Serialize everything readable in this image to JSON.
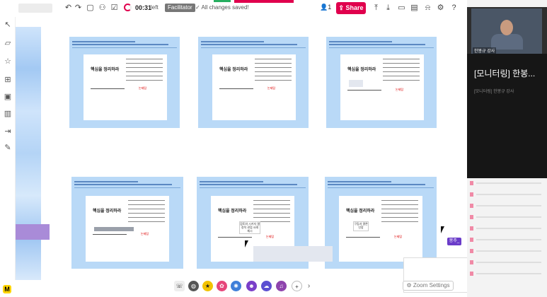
{
  "toolbar": {
    "timer": "00:31",
    "timer_suffix": "left",
    "facilitator_badge": "Facilitator",
    "saved_status": "All changes saved!",
    "user_count": "1",
    "share_label": "Share"
  },
  "slides": [
    {
      "title": "핵심을 정리하라",
      "red_note": "논제탐"
    },
    {
      "title": "핵심을 정리하라",
      "red_note": "논제탐"
    },
    {
      "title": "핵심을 정리하라",
      "red_note": "논제탐"
    },
    {
      "title": "핵심을 정리하라",
      "red_note": "논제탐"
    },
    {
      "title": "핵심을 정리하라",
      "red_note": "논제탐",
      "memo": "검토와 시키자 결정적 관점 사례 제시"
    },
    {
      "title": "핵심을 정리하라",
      "red_note": "논제탐",
      "memo": "구립과 결론인함"
    }
  ],
  "video_panel": {
    "speaker_name": "한봉규 강사",
    "monitor_name": "[모니터링] 한봉...",
    "monitor_sub": "[모니터링] 한봉규 강사"
  },
  "zoom": {
    "settings_label": "Zoom Settings"
  },
  "floating_tag": "봉주_",
  "icons": {
    "undo": "undo-icon",
    "redo": "redo-icon",
    "frame": "frame-icon",
    "share": "share-icon",
    "download": "download-icon"
  },
  "colors": {
    "accent": "#e0004d",
    "frame_bg": "#b9d9f7",
    "facilitator": "#777777"
  }
}
